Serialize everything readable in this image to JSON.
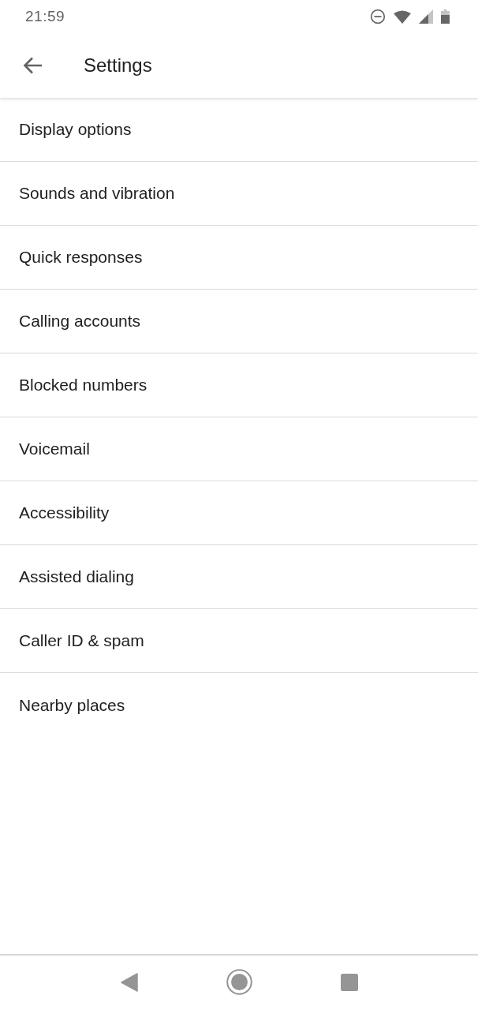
{
  "status_bar": {
    "time": "21:59"
  },
  "toolbar": {
    "title": "Settings"
  },
  "settings_items": [
    {
      "label": "Display options"
    },
    {
      "label": "Sounds and vibration"
    },
    {
      "label": "Quick responses"
    },
    {
      "label": "Calling accounts"
    },
    {
      "label": "Blocked numbers"
    },
    {
      "label": "Voicemail"
    },
    {
      "label": "Accessibility"
    },
    {
      "label": "Assisted dialing"
    },
    {
      "label": "Caller ID & spam"
    },
    {
      "label": "Nearby places"
    }
  ]
}
